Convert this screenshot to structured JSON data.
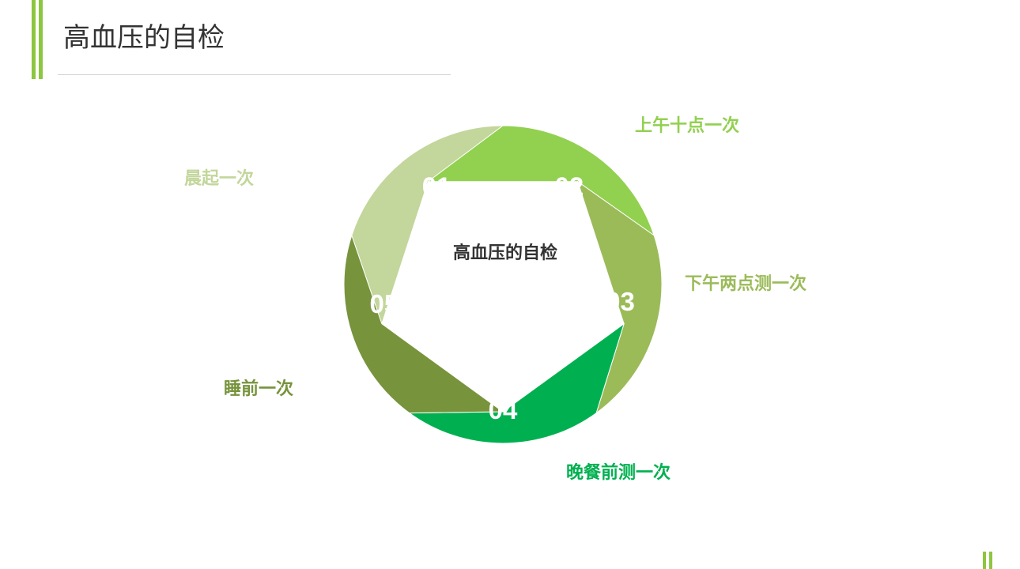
{
  "title": "高血压的自检",
  "diagram": {
    "center_label": "高血压的自检",
    "steps": [
      {
        "number": "01",
        "label": "晨起一次",
        "color": "#c3d69b"
      },
      {
        "number": "02",
        "label": "上午十点一次",
        "color": "#92d050"
      },
      {
        "number": "03",
        "label": "下午两点测一次",
        "color": "#9bbb59"
      },
      {
        "number": "04",
        "label": "晚餐前测一次",
        "color": "#00b050"
      },
      {
        "number": "05",
        "label": "睡前一次",
        "color": "#77933c"
      }
    ]
  },
  "colors": {
    "accent": "#8dc63f",
    "title_text": "#333333",
    "rule": "#d4d4d4"
  }
}
